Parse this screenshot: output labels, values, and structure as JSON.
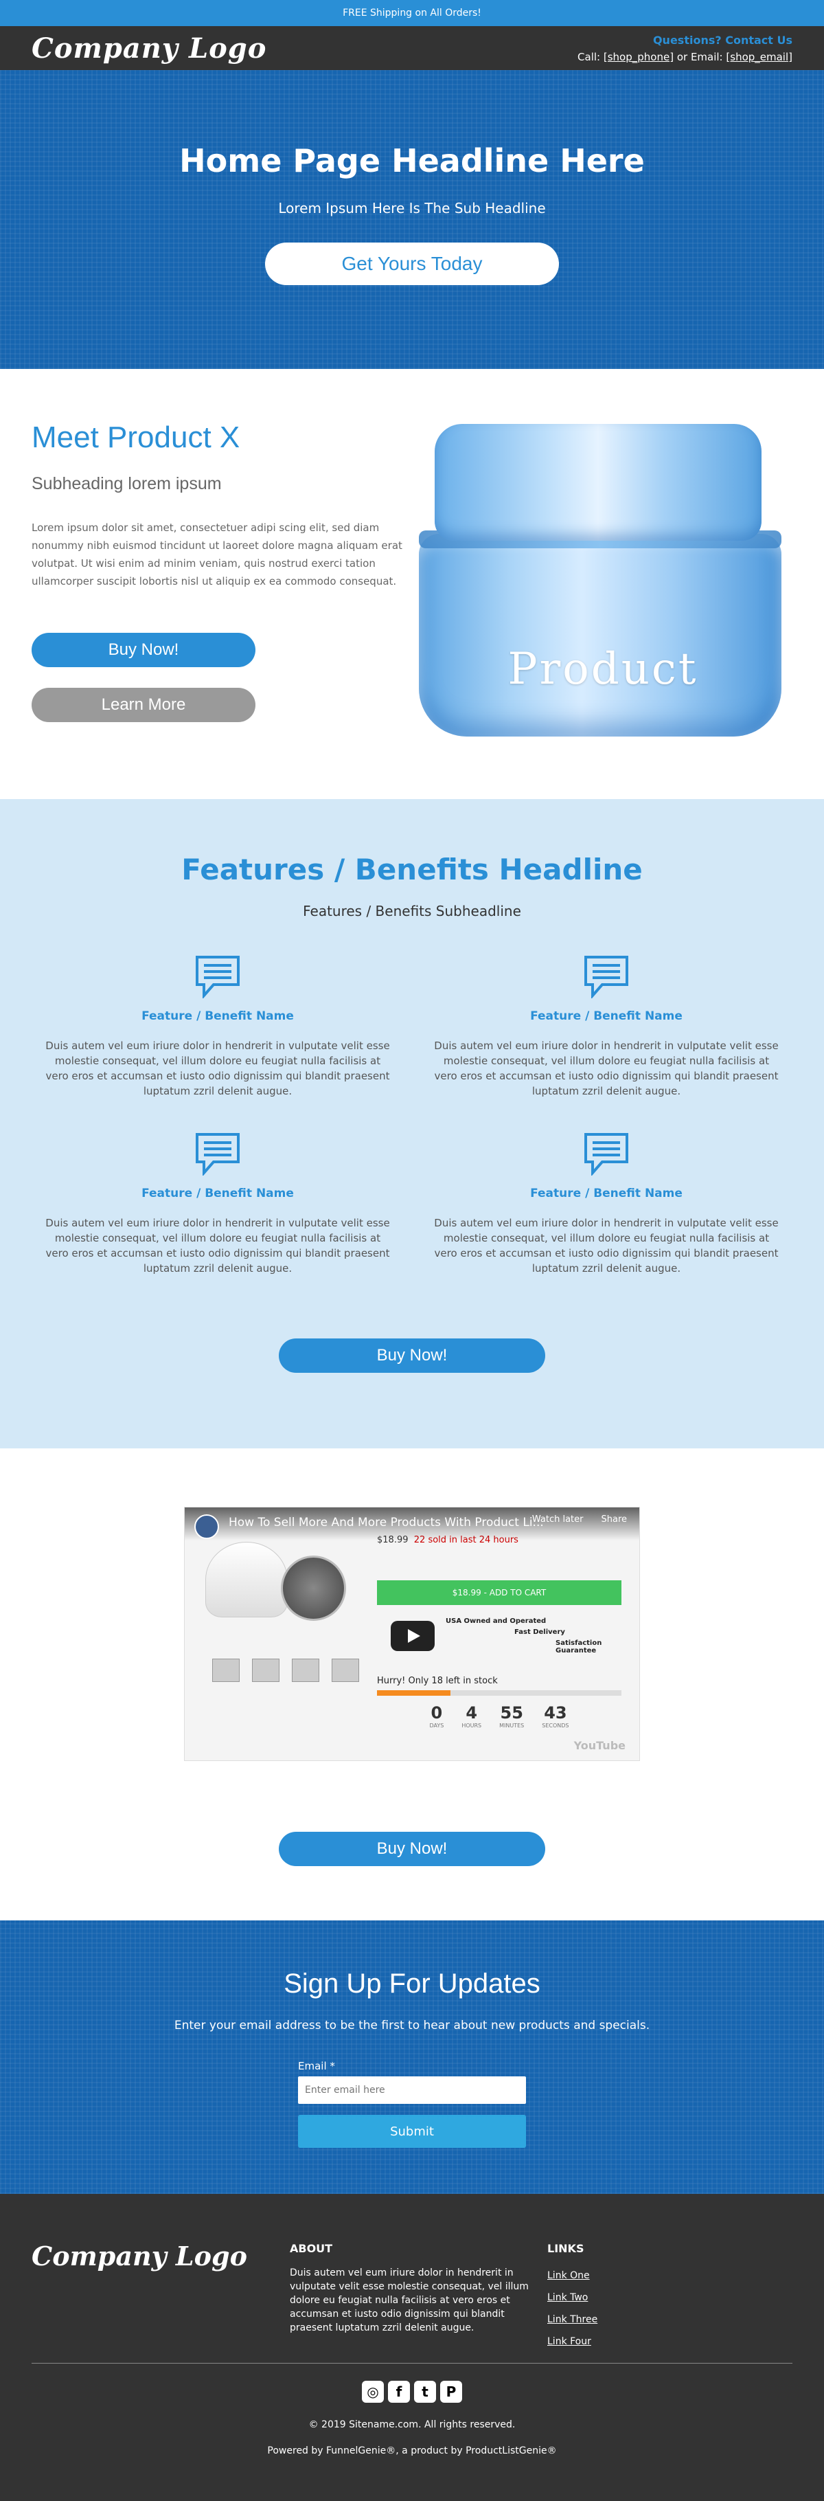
{
  "topbar": {
    "text": "FREE Shipping on All Orders!"
  },
  "header": {
    "logo": "Company Logo",
    "questions": "Questions? Contact Us",
    "call_prefix": "Call:",
    "phone": "[shop_phone]",
    "or_email": "or Email:",
    "email": "[shop_email]"
  },
  "hero": {
    "headline": "Home Page Headline Here",
    "subheadline": "Lorem Ipsum Here Is The Sub Headline",
    "cta": "Get Yours Today"
  },
  "product": {
    "title": "Meet Product X",
    "subheading": "Subheading lorem ipsum",
    "paragraph": "Lorem ipsum dolor sit amet, consectetuer adipi scing elit, sed diam nonummy nibh euismod tincidunt ut laoreet dolore magna aliquam erat volutpat. Ut wisi enim ad minim veniam, quis nostrud exerci tation ullamcorper suscipit lobortis nisl ut aliquip ex ea commodo consequat.",
    "buy_now": "Buy Now!",
    "learn_more": "Learn More",
    "jar_label": "Product"
  },
  "features": {
    "headline": "Features / Benefits Headline",
    "subheadline": "Features / Benefits Subheadline",
    "items": [
      {
        "name": "Feature / Benefit Name",
        "desc": "Duis autem vel eum iriure dolor in hendrerit in vulputate velit esse molestie consequat, vel illum dolore eu feugiat nulla facilisis at vero eros et accumsan et iusto odio dignissim qui blandit praesent luptatum zzril delenit augue.",
        "icon": "chat-icon"
      },
      {
        "name": "Feature / Benefit Name",
        "desc": "Duis autem vel eum iriure dolor in hendrerit in vulputate velit esse molestie consequat, vel illum dolore eu feugiat nulla facilisis at vero eros et accumsan et iusto odio dignissim qui blandit praesent luptatum zzril delenit augue.",
        "icon": "chat-icon"
      },
      {
        "name": "Feature / Benefit Name",
        "desc": "Duis autem vel eum iriure dolor in hendrerit in vulputate velit esse molestie consequat, vel illum dolore eu feugiat nulla facilisis at vero eros et accumsan et iusto odio dignissim qui blandit praesent luptatum zzril delenit augue.",
        "icon": "chat-icon"
      },
      {
        "name": "Feature / Benefit Name",
        "desc": "Duis autem vel eum iriure dolor in hendrerit in vulputate velit esse molestie consequat, vel illum dolore eu feugiat nulla facilisis at vero eros et accumsan et iusto odio dignissim qui blandit praesent luptatum zzril delenit augue.",
        "icon": "chat-icon"
      }
    ],
    "buy_now": "Buy Now!"
  },
  "video": {
    "title": "How To Sell More And More Products With Product Li...",
    "watch_later": "Watch later",
    "share": "Share",
    "price_text": "$18.99",
    "sold_text": "22 sold in last 24 hours",
    "add_to_cart": "$18.99 - ADD TO CART",
    "trust_1": "USA Owned and Operated",
    "trust_2": "Fast Delivery",
    "trust_3": "Satisfaction Guarantee",
    "hurry": "Hurry! Only 18 left in stock",
    "timer": [
      {
        "n": "0",
        "l": "DAYS"
      },
      {
        "n": "4",
        "l": "HOURS"
      },
      {
        "n": "55",
        "l": "MINUTES"
      },
      {
        "n": "43",
        "l": "SECONDS"
      }
    ],
    "youtube": "YouTube",
    "buy_now": "Buy Now!"
  },
  "signup": {
    "headline": "Sign Up For Updates",
    "text": "Enter your email address to be the first to hear about new products and specials.",
    "email_label": "Email *",
    "email_placeholder": "Enter email here",
    "submit": "Submit"
  },
  "footer": {
    "logo": "Company Logo",
    "about_title": "ABOUT",
    "about_text": "Duis autem vel eum iriure dolor in hendrerit in vulputate velit esse molestie consequat, vel illum dolore eu feugiat nulla facilisis at vero eros et accumsan et iusto odio dignissim qui blandit praesent luptatum zzril delenit augue.",
    "links_title": "LINKS",
    "links": [
      "Link One",
      "Link Two",
      "Link Three",
      "Link Four"
    ],
    "social": [
      {
        "icon": "instagram-icon",
        "glyph": "◎"
      },
      {
        "icon": "facebook-icon",
        "glyph": "f"
      },
      {
        "icon": "twitter-icon",
        "glyph": "t"
      },
      {
        "icon": "pinterest-icon",
        "glyph": "P"
      }
    ],
    "copyright": "© 2019 Sitename.com. All rights reserved.",
    "powered": "Powered by FunnelGenie®, a product by ProductListGenie®"
  },
  "colors": {
    "accent": "#2a8fd6",
    "dark": "#333333",
    "hero_blue": "#1765b0",
    "features_bg": "#d3e8f7",
    "gray_button": "#9a9a9a"
  }
}
